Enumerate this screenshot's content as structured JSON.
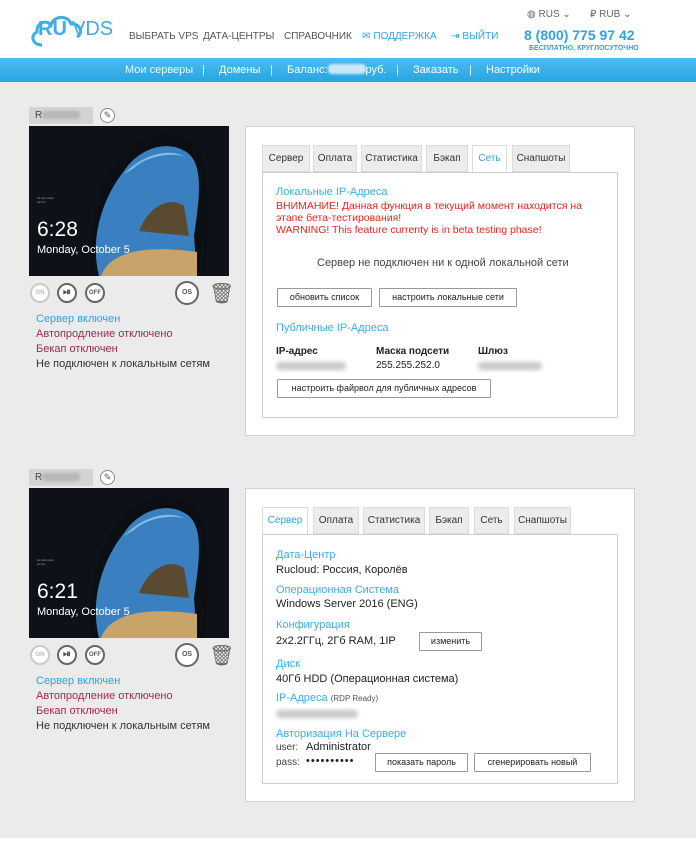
{
  "header": {
    "logo_ru": "RU",
    "logo_vds": "VDS",
    "nav": [
      "ВЫБРАТЬ VPS",
      "ДАТА-ЦЕНТРЫ",
      "СПРАВОЧНИК"
    ],
    "support": "ПОДДЕРЖКА",
    "logout": "ВЫЙТИ",
    "lang": "RUS",
    "currency": "RUB",
    "phone": "8 (800) 775 97 42",
    "phone_sub": "БЕСПЛАТНО, КРУГЛОСУТОЧНО"
  },
  "subnav": {
    "my_servers": "Мои серверы",
    "domains": "Домены",
    "balance_label": "Баланс:",
    "balance_unit": "руб.",
    "order": "Заказать",
    "settings": "Настройки",
    "sep": "|"
  },
  "servers": [
    {
      "name": "R",
      "screen_time": "6:28",
      "screen_date": "Monday, October 5",
      "ctrl": {
        "on": "ON",
        "off": "OFF",
        "os": "OS"
      },
      "status": [
        "Сервер включен",
        "Автопродление отключено",
        "Бекап отключен",
        "Не подключен к локальным сетям"
      ],
      "tabs": [
        "Сервер",
        "Оплата",
        "Статистика",
        "Бэкап",
        "Сеть",
        "Снапшоты"
      ],
      "active_tab": "Сеть",
      "net": {
        "local_title": "Локальные IP-Адреса",
        "warn1": "ВНИМАНИЕ! Данная функция в текущий момент находится на",
        "warn2": "этапе бета-тестирования!",
        "warn3": "WARNING! This feature currenty is in beta testing phase!",
        "no_net": "Сервер не подключен ни к одной локальной сети",
        "refresh_btn": "обновить список",
        "setup_btn": "настроить локальные сети",
        "public_title": "Публичные IP-Адреса",
        "col_ip": "IP-адрес",
        "col_mask": "Маска подсети",
        "col_gw": "Шлюз",
        "mask": "255.255.252.0",
        "firewall_btn": "настроить файрвол для публичных адресов"
      }
    },
    {
      "name": "R",
      "screen_time": "6:21",
      "screen_date": "Monday, October 5",
      "ctrl": {
        "on": "ON",
        "off": "OFF",
        "os": "OS"
      },
      "status": [
        "Сервер включен",
        "Автопродление отключено",
        "Бекап отключен",
        "Не подключен к локальным сетям"
      ],
      "tabs": [
        "Сервер",
        "Оплата",
        "Статистика",
        "Бэкап",
        "Сеть",
        "Снапшоты"
      ],
      "active_tab": "Сервер",
      "info": {
        "dc_title": "Дата-Центр",
        "dc": "Rucloud: Россия, Королёв",
        "os_title": "Операционная Система",
        "os": "Windows Server 2016 (ENG)",
        "cfg_title": "Конфигурация",
        "cfg": "2x2.2ГГц, 2Гб RAM, 1IP",
        "change_btn": "изменить",
        "disk_title": "Диск",
        "disk": "40Гб HDD (Операционная система)",
        "ip_title": "IP-Адреса",
        "ip_note": "(RDP Ready)",
        "auth_title": "Авторизация На Сервере",
        "user_label": "user:",
        "user": "Administrator",
        "pass_label": "pass:",
        "pass": "••••••••••",
        "show_pass_btn": "показать пароль",
        "gen_btn": "сгенерировать новый"
      }
    }
  ]
}
